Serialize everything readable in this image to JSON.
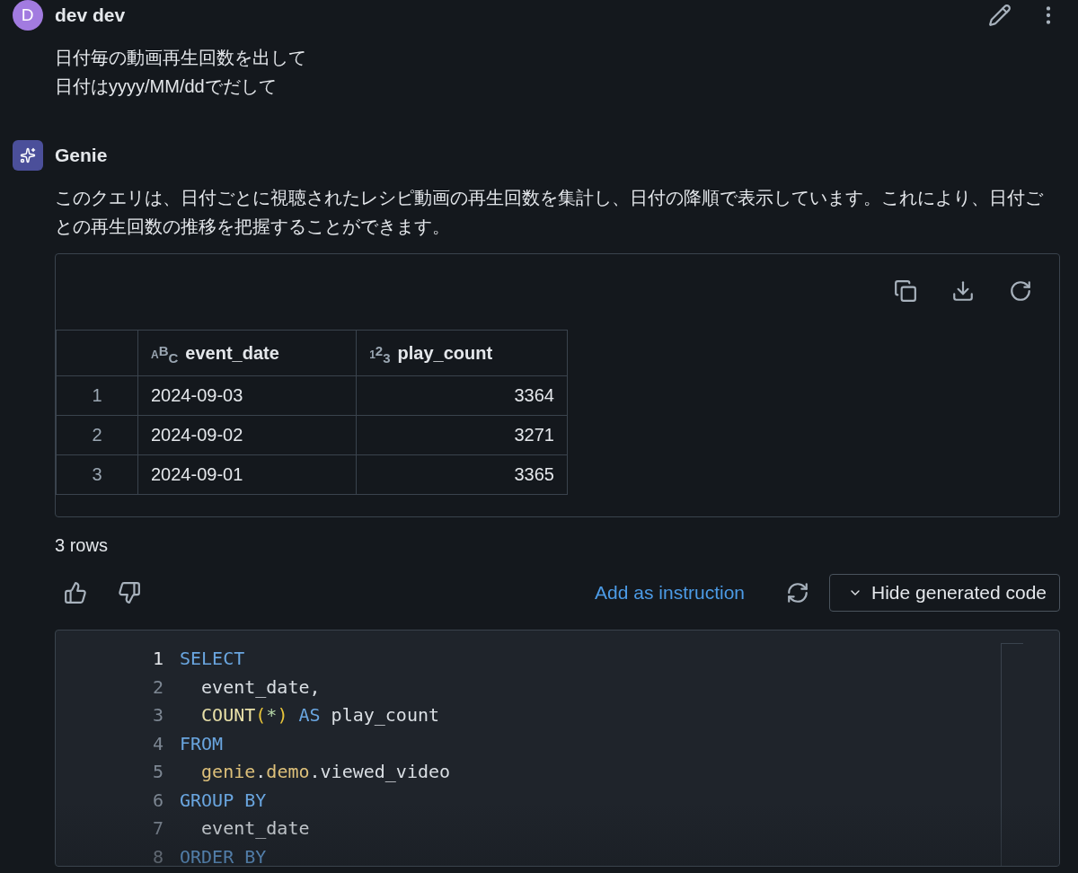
{
  "user_message": {
    "avatar_letter": "D",
    "author": "dev dev",
    "lines": [
      "日付毎の動画再生回数を出して",
      "日付はyyyy/MM/ddでだして"
    ]
  },
  "reply": {
    "author": "Genie",
    "text": "このクエリは、日付ごとに視聴されたレシピ動画の再生回数を集計し、日付の降順で表示しています。これにより、日付ごとの再生回数の推移を把握することができます。",
    "table": {
      "columns": [
        {
          "name": "event_date",
          "type_glyphs": "ABC"
        },
        {
          "name": "play_count",
          "type_glyphs": "123"
        }
      ],
      "rows": [
        {
          "index": "1",
          "cells": [
            "2024-09-03",
            "3364"
          ]
        },
        {
          "index": "2",
          "cells": [
            "2024-09-02",
            "3271"
          ]
        },
        {
          "index": "3",
          "cells": [
            "2024-09-01",
            "3365"
          ]
        }
      ]
    },
    "row_count": "3 rows",
    "add_instruction": "Add as instruction",
    "toggle_code": {
      "label": "Hide generated code",
      "expanded": true
    },
    "code": {
      "lines": [
        {
          "number": "1",
          "active": true,
          "tokens": [
            {
              "text": "SELECT",
              "kind": "keyword"
            }
          ]
        },
        {
          "number": "2",
          "active": false,
          "tokens": [
            {
              "text": "  event_date,",
              "kind": "plain"
            }
          ]
        },
        {
          "number": "3",
          "active": false,
          "tokens": [
            {
              "text": "  COUNT",
              "kind": "function"
            },
            {
              "text": "(",
              "kind": "paren"
            },
            {
              "text": "*",
              "kind": "star"
            },
            {
              "text": ")",
              "kind": "paren"
            },
            {
              "text": " AS",
              "kind": "keyword"
            },
            {
              "text": " play_count",
              "kind": "plain"
            }
          ]
        },
        {
          "number": "4",
          "active": false,
          "tokens": [
            {
              "text": "FROM",
              "kind": "keyword"
            }
          ]
        },
        {
          "number": "5",
          "active": false,
          "tokens": [
            {
              "text": "  genie",
              "kind": "schema"
            },
            {
              "text": ".",
              "kind": "plain"
            },
            {
              "text": "demo",
              "kind": "schema"
            },
            {
              "text": ".viewed_video",
              "kind": "plain"
            }
          ]
        },
        {
          "number": "6",
          "active": false,
          "tokens": [
            {
              "text": "GROUP BY",
              "kind": "keyword"
            }
          ]
        },
        {
          "number": "7",
          "active": false,
          "tokens": [
            {
              "text": "  event_date",
              "kind": "plain"
            }
          ]
        },
        {
          "number": "8",
          "active": false,
          "tokens": [
            {
              "text": "ORDER BY",
              "kind": "keyword"
            }
          ]
        }
      ]
    }
  }
}
